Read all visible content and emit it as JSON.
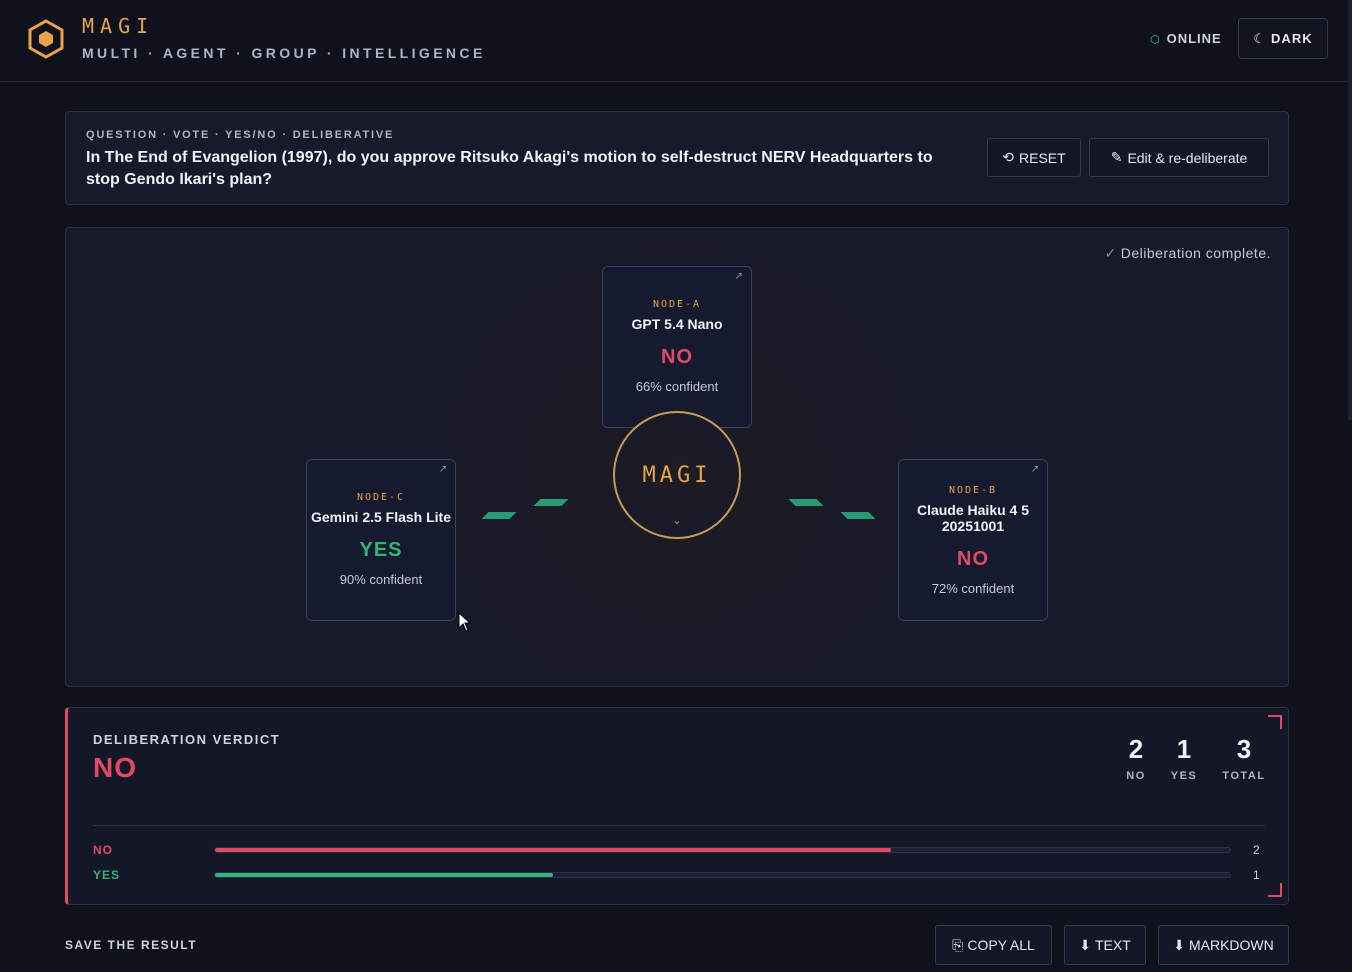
{
  "header": {
    "title": "MAGI",
    "subtitle": "MULTI · AGENT · GROUP · INTELLIGENCE",
    "status": "ONLINE",
    "status_color": "#34c27f",
    "theme_label": "DARK",
    "accent_color": "#e8a24a"
  },
  "question": {
    "meta": "QUESTION · VOTE · YES/NO · DELIBERATIVE",
    "text": "In The End of Evangelion (1997), do you approve Ritsuko Akagi's motion to self-destruct NERV Headquarters to stop Gendo Ikari's plan?",
    "reset_label": "RESET",
    "edit_label": "Edit & re-deliberate"
  },
  "stage": {
    "status": "Deliberation complete.",
    "core_label": "MAGI",
    "nodes": [
      {
        "tag": "NODE-A",
        "model": "GPT 5.4 Nano",
        "vote": "NO",
        "confidence": "66% confident"
      },
      {
        "tag": "NODE-B",
        "model": "Claude Haiku 4 5 20251001",
        "vote": "NO",
        "confidence": "72% confident"
      },
      {
        "tag": "NODE-C",
        "model": "Gemini 2.5 Flash Lite",
        "vote": "YES",
        "confidence": "90% confident"
      }
    ]
  },
  "verdict": {
    "label": "DELIBERATION VERDICT",
    "result": "NO",
    "tallies": [
      {
        "num": "2",
        "label": "NO"
      },
      {
        "num": "1",
        "label": "YES"
      },
      {
        "num": "3",
        "label": "TOTAL"
      }
    ],
    "bars": [
      {
        "label": "NO",
        "count": "2",
        "fraction": 0.666,
        "color": "#e04a64"
      },
      {
        "label": "YES",
        "count": "1",
        "fraction": 0.333,
        "color": "#31b47a"
      }
    ]
  },
  "save": {
    "label": "SAVE THE RESULT",
    "copy_label": "COPY ALL",
    "text_label": "TEXT",
    "markdown_label": "MARKDOWN"
  }
}
